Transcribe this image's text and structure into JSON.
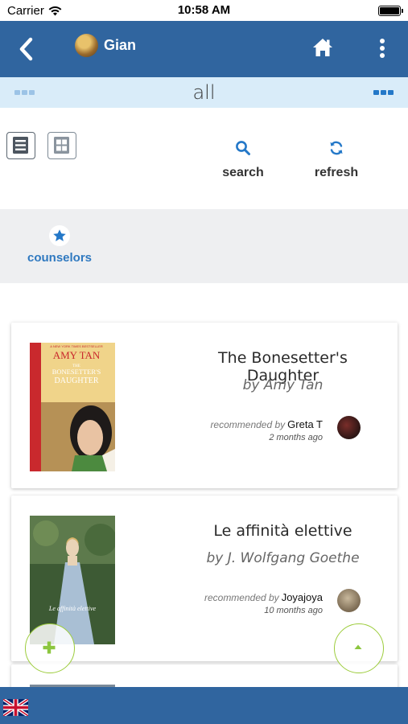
{
  "status_bar": {
    "carrier": "Carrier",
    "time": "10:58 AM"
  },
  "header": {
    "username": "Gian",
    "icons": {
      "back": "chevron-left-icon",
      "home": "home-icon",
      "more": "more-vertical-icon"
    }
  },
  "filter": {
    "title": "all"
  },
  "toolbar": {
    "view_modes": [
      "list-view-icon",
      "grid-view-icon"
    ],
    "search_label": "search",
    "refresh_label": "refresh"
  },
  "counselors": {
    "label": "counselors",
    "icon": "star-icon"
  },
  "books": [
    {
      "cover_lines": [
        "A NEW YORK TIMES BESTSELLER",
        "AMY TAN",
        "THE",
        "BONESETTER'S",
        "DAUGHTER"
      ],
      "title": "The Bonesetter's Daughter",
      "author": "by Amy Tan",
      "recommended_prefix": "recommended by",
      "recommender": "Greta T",
      "time_ago": "2 months ago"
    },
    {
      "cover_lines": [
        "Le affinità elettive"
      ],
      "title": "Le affinità elettive",
      "author": "by J. Wolfgang Goethe",
      "recommended_prefix": "recommended by",
      "recommender": "Joyajoya",
      "time_ago": "10 months ago"
    }
  ],
  "fabs": {
    "add": "plus-icon",
    "scroll_top": "caret-up-icon"
  },
  "colors": {
    "primary": "#30659f",
    "filter_bg": "#d9ecf9",
    "accent_blue": "#2f79c0",
    "fab_green": "#9ccc3b"
  },
  "language_flag": "uk-flag-icon"
}
